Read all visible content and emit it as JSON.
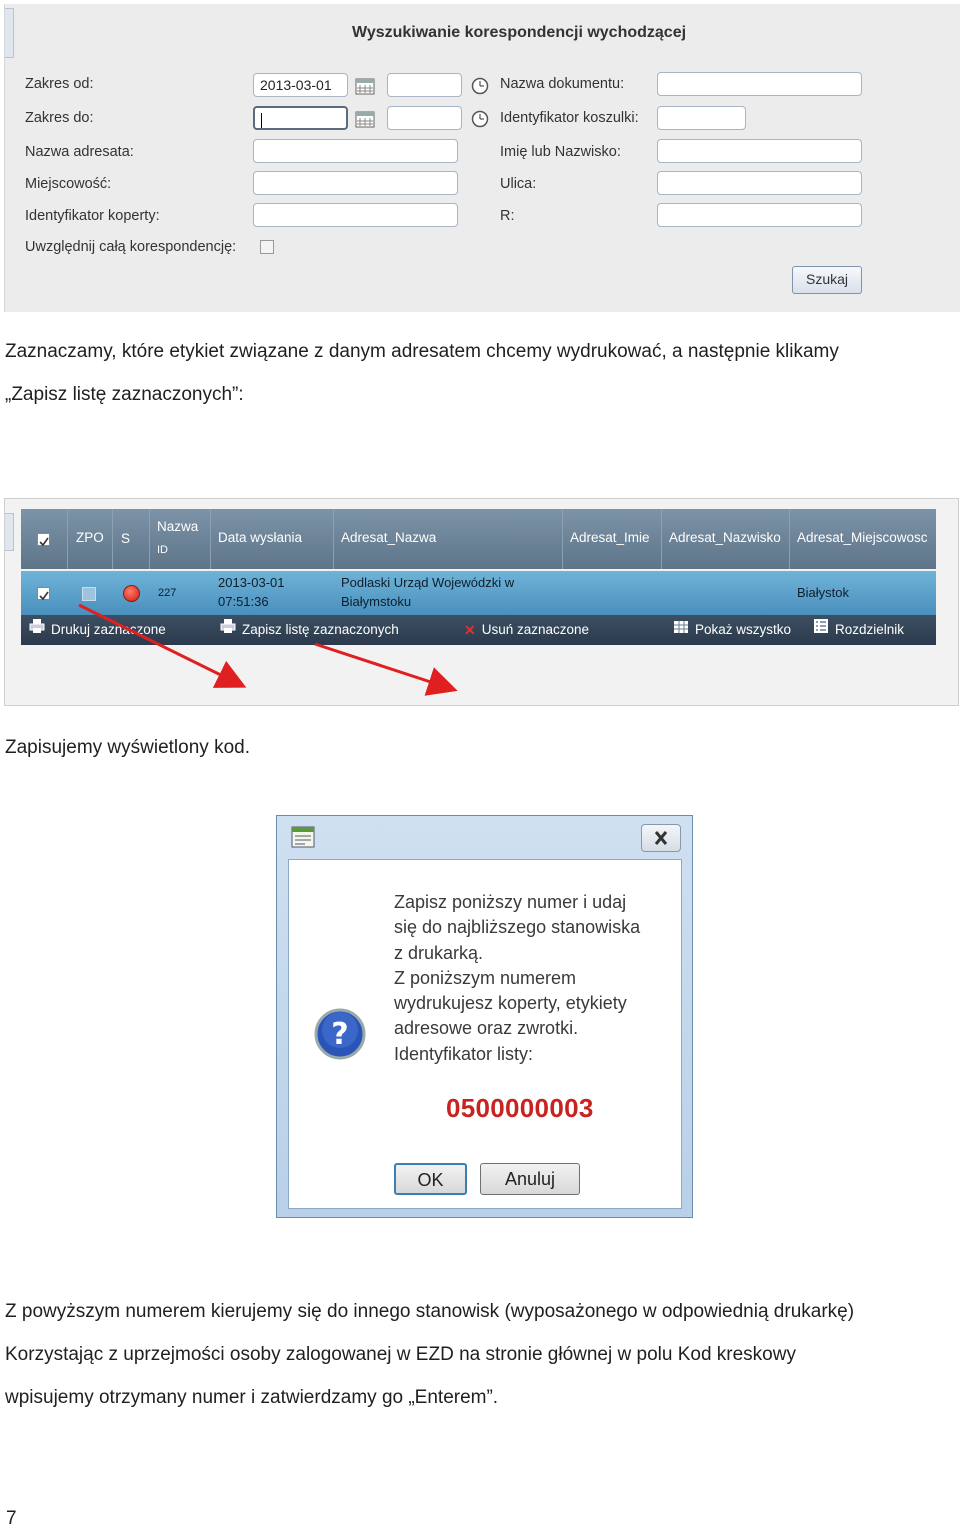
{
  "search_form": {
    "title": "Wyszukiwanie korespondencji wychodzącej",
    "labels": {
      "range_from": "Zakres od:",
      "range_to": "Zakres do:",
      "addressee_name": "Nazwa adresata:",
      "city": "Miejscowość:",
      "envelope_id": "Identyfikator koperty:",
      "include_all": "Uwzględnij całą korespondencję:",
      "document_name": "Nazwa dokumentu:",
      "basket_id": "Identyfikator koszulki:",
      "first_or_last_name": "Imię lub Nazwisko:",
      "street": "Ulica:",
      "r": "R:"
    },
    "range_from_value": "2013-03-01",
    "search_button": "Szukaj"
  },
  "paragraph1": {
    "line1": "Zaznaczamy, które etykiet związane z danym adresatem chcemy wydrukować, a następnie klikamy",
    "line2": "„Zapisz listę zaznaczonych”:"
  },
  "grid": {
    "headers": {
      "zpo": "ZPO",
      "s": "S",
      "name": "Nazwa",
      "id": "ID",
      "sent_date": "Data wysłania",
      "addressee_name": "Adresat_Nazwa",
      "addressee_first": "Adresat_Imie",
      "addressee_last": "Adresat_Nazwisko",
      "addressee_city": "Adresat_Miejscowosc"
    },
    "row": {
      "id": "227",
      "date": "2013-03-01",
      "time": "07:51:36",
      "name_line1": "Podlaski Urząd Wojewódzki w",
      "name_line2": "Białymstoku",
      "city": "Białystok"
    },
    "toolbar": {
      "print_selected": "Drukuj zaznaczone",
      "save_selected": "Zapisz listę zaznaczonych",
      "remove_selected": "Usuń zaznaczone",
      "show_all": "Pokaż wszystko",
      "distribution": "Rozdzielnik"
    }
  },
  "paragraph2": "Zapisujemy wyświetlony kod.",
  "dialog": {
    "message_lines": [
      "Zapisz poniższy numer i udaj",
      "się do najbliższego stanowiska",
      "z drukarką.",
      "Z poniższym numerem",
      "wydrukujesz koperty, etykiety",
      "adresowe oraz zwrotki.",
      "Identyfikator listy:"
    ],
    "list_id": "0500000003",
    "ok": "OK",
    "cancel": "Anuluj"
  },
  "paragraph3": {
    "line1": "Z powyższym numerem kierujemy się do innego stanowisk (wyposażonego w odpowiednią drukarkę)",
    "line2": "Korzystając z uprzejmości osoby zalogowanej w EZD na stronie głównej w polu Kod kreskowy",
    "line3": "wpisujemy otrzymany numer i zatwierdzamy go „Enterem”."
  },
  "page_number": "7",
  "colors": {
    "arrow": "#e02020",
    "list_id": "#c8231f",
    "grid_header": "#6a8196",
    "grid_row": "#5ea3cc",
    "toolbar": "#33445a"
  },
  "icons": [
    "calendar-icon",
    "clock-icon",
    "printer-icon",
    "remove-icon",
    "show-all-icon",
    "distribution-icon",
    "question-icon",
    "close-icon",
    "window-icon"
  ]
}
